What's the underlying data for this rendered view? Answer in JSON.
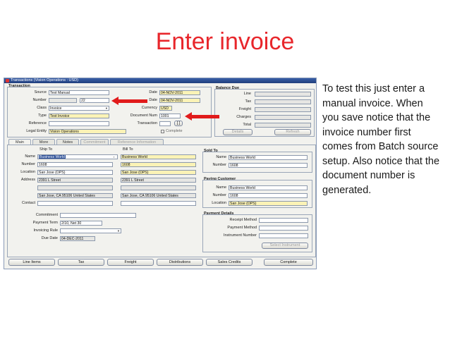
{
  "slide": {
    "title": "Enter invoice",
    "note": "To test this just enter a manual invoice. When you save notice that the invoice number first comes from Batch source setup. Also notice that the document number is generated."
  },
  "window": {
    "title": "Transactions (Vision Operations : USD)"
  },
  "transaction": {
    "header": "Transaction",
    "source_label": "Source",
    "source": "Test Manual",
    "number_label": "Number",
    "number": "",
    "number2": "22",
    "class_label": "Class",
    "class": "Invoice",
    "type_label": "Type",
    "type": "Test Invoice",
    "reference_label": "Reference",
    "reference": "",
    "legal_entity_label": "Legal Entity",
    "legal_entity": "Vision Operations",
    "date_label": "Date",
    "date": "04-NOV-2011",
    "gl_date_label": "Date",
    "gl_date": "04-NOV-2011",
    "currency_label": "Currency",
    "currency": "USD",
    "doc_num_label": "Document Num",
    "doc_num": "1001",
    "trans_label": "Transaction",
    "trans": "",
    "complete_label": "Complete"
  },
  "balance_due": {
    "header": "Balance Due",
    "line_label": "Line",
    "tax_label": "Tax",
    "freight_label": "Freight",
    "charges_label": "Charges",
    "total_label": "Total",
    "details_button": "Details",
    "refresh_button": "Refresh"
  },
  "tabs": [
    {
      "label": "Main"
    },
    {
      "label": "More"
    },
    {
      "label": "Notes"
    },
    {
      "label": "Commitment"
    },
    {
      "label": "Reference Information"
    }
  ],
  "main": {
    "ship_to_header": "Ship To",
    "bill_to_header": "Bill To",
    "name_label": "Name",
    "number_label": "Number",
    "location_label": "Location",
    "address_label": "Address",
    "contact_label": "Contact",
    "ship_name": "Business World",
    "ship_number": "1608",
    "ship_location": "San Jose (OPS)",
    "ship_address": "2391 L Street",
    "ship_city": "San Jose, CA 95106 United States",
    "bill_name": "Business World",
    "bill_number": "1608",
    "bill_location": "San Jose (OPS)",
    "bill_address": "2391 L Street",
    "bill_city": "San Jose, CA 95106 United States",
    "commitment_label": "Commitment",
    "commitment": "",
    "payment_term_label": "Payment Term",
    "payment_term": "2/10, Net 30",
    "invoicing_rule_label": "Invoicing Rule",
    "invoicing_rule": "",
    "due_date_label": "Due Date",
    "due_date": "04-DEC-2011"
  },
  "sold_to": {
    "header": "Sold To",
    "name_label": "Name",
    "name": "Business World",
    "number_label": "Number",
    "number": "1608"
  },
  "paying_customer": {
    "header": "Paying Customer",
    "name_label": "Name",
    "name": "Business World",
    "number_label": "Number",
    "number": "1608",
    "location_label": "Location",
    "location": "San Jose (OPS)"
  },
  "payment_details": {
    "header": "Payment Details",
    "receipt_method_label": "Receipt Method",
    "payment_method_label": "Payment Method",
    "instrument_number_label": "Instrument Number",
    "select_instrument_button": "Select Instrument"
  },
  "bottom_buttons": {
    "line_items": "Line Items",
    "tax": "Tax",
    "freight": "Freight",
    "distributions": "Distributions",
    "sales_credits": "Sales Credits",
    "complete": "Complete"
  },
  "colors": {
    "title_red": "#e8262b",
    "arrow_red": "#e11b1b",
    "required_yellow": "#fbf3b6"
  }
}
